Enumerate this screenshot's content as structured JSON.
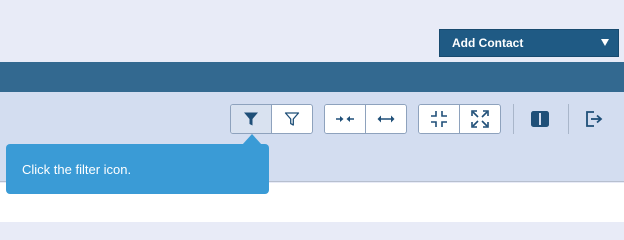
{
  "header": {
    "add_contact_label": "Add Contact"
  },
  "toolbar": {
    "icons": [
      "filter-filled-icon",
      "filter-outline-icon",
      "collapse-horizontal-icon",
      "expand-horizontal-icon",
      "collapse-icon",
      "expand-icon",
      "columns-icon",
      "export-icon"
    ],
    "pressed": "filter-filled-icon"
  },
  "tooltip": {
    "text": "Click the filter icon."
  },
  "colors": {
    "page_bg": "#e8ebf7",
    "accent_dark": "#1f5a84",
    "band": "#336990",
    "toolbar_bg": "#d3ddf0",
    "icon": "#1f4f78",
    "tooltip_bg": "#3a9bd6"
  }
}
